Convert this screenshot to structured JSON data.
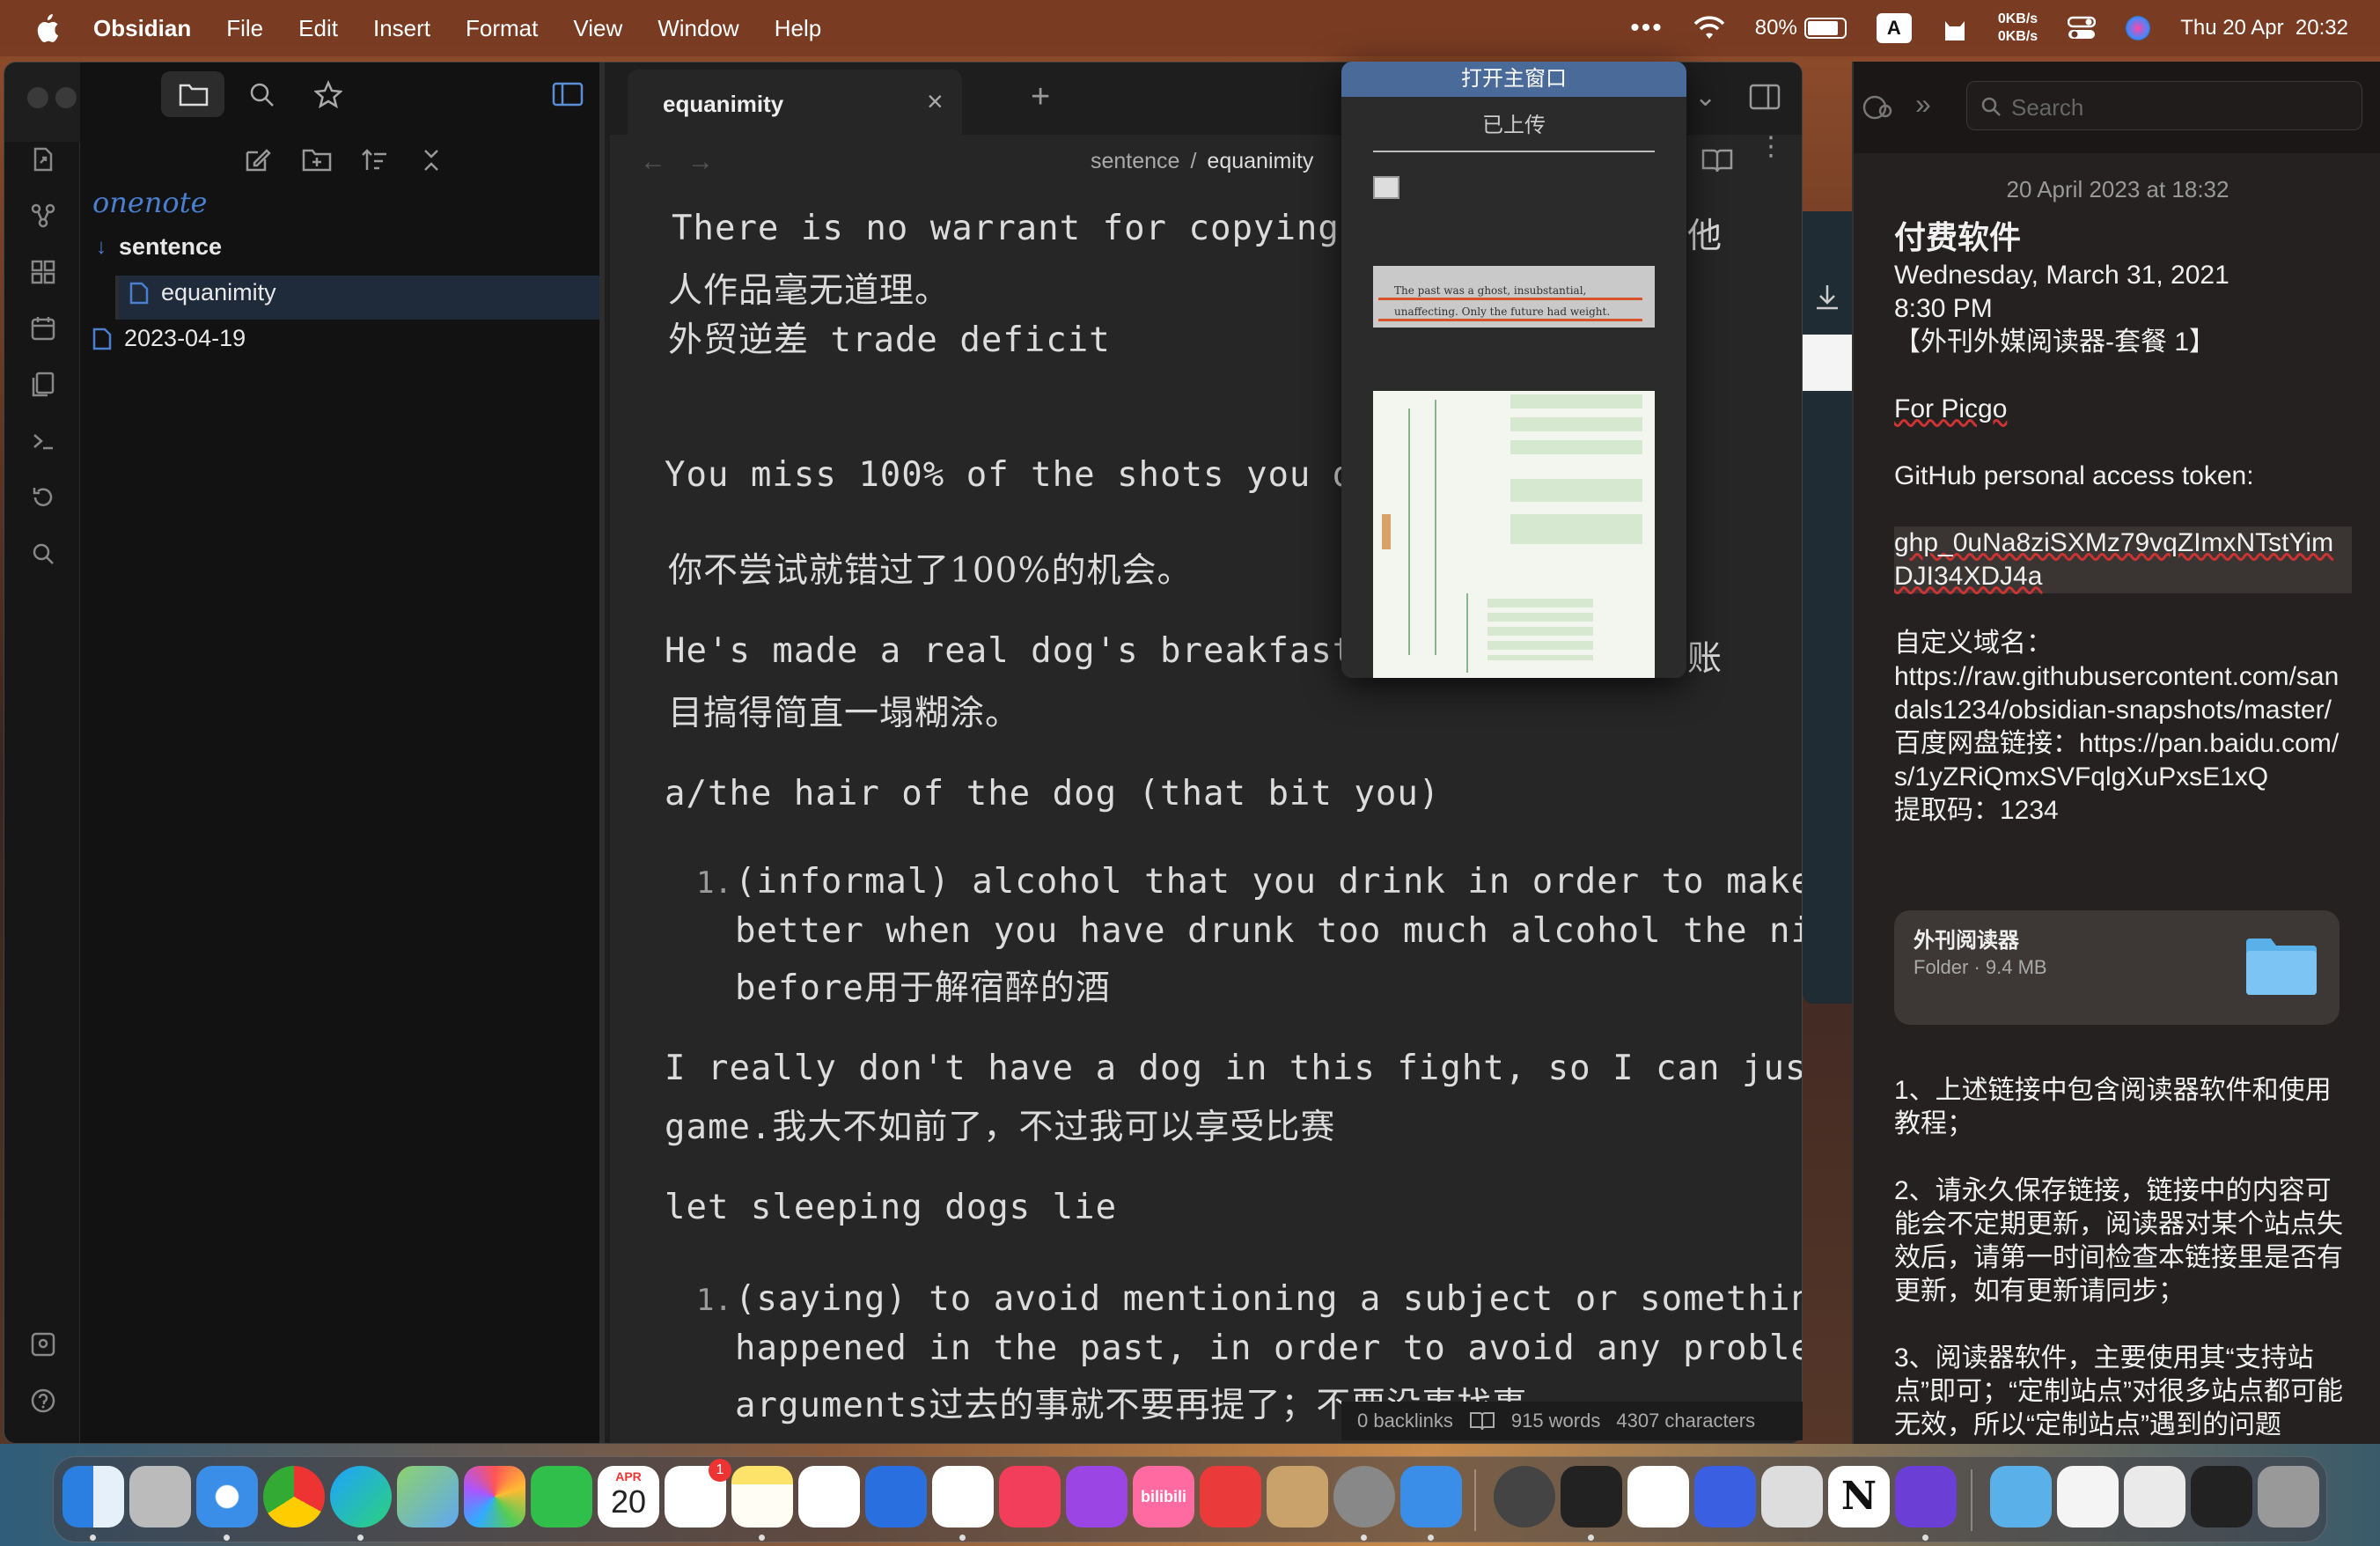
{
  "menubar": {
    "app_name": "Obsidian",
    "items": [
      "File",
      "Edit",
      "Insert",
      "Format",
      "View",
      "Window",
      "Help"
    ],
    "battery": "80%",
    "input_source": "A",
    "net_up": "0KB/s",
    "net_down": "0KB/s",
    "datetime": "Thu 20 Apr  20:32"
  },
  "filepane": {
    "vault": "onenote",
    "folder": "sentence",
    "items": [
      "equanimity",
      "2023-04-19"
    ]
  },
  "editor": {
    "tab": "equanimity",
    "breadcrumb_folder": "sentence",
    "breadcrumb_sep": "/",
    "breadcrumb_file": "equanimity",
    "lines": [
      "There is no warrant for copying other",
      "人作品毫无道理。",
      "外贸逆差 trade deficit",
      "You miss 100% of the shots you don't ta",
      "你不尝试就错过了100%的机会。",
      "He's made a real dog's breakfast of the",
      "目搞得简直一塌糊涂。",
      "a/the hair of the dog (that bit you)",
      "(informal) alcohol that you drink in order to make you feel",
      "better when you have drunk too much alcohol the night",
      "before用于解宿醉的酒",
      "I really don't have a dog in this fight, so I can just enjoy the",
      "game.我大不如前了，不过我可以享受比赛",
      "let sleeping dogs lie",
      "(saying) to avoid mentioning a subject or something that",
      "happened in the past, in order to avoid any problems or",
      "arguments过去的事就不要再提了；不要没事找事"
    ],
    "overflow_right": [
      "他",
      "账"
    ],
    "list_numbers": [
      "1.",
      "1."
    ]
  },
  "popup": {
    "title": "打开主窗口",
    "subtitle": "已上传",
    "thumb_text": "The past was a ghost, insubstantial, unaffecting. Only the future had weight."
  },
  "status": {
    "backlinks": "0 backlinks",
    "words": "915 words",
    "chars": "4307 characters"
  },
  "notes": {
    "search_placeholder": "Search",
    "date": "20 April 2023 at 18:32",
    "title": "付费软件",
    "lines": [
      "Wednesday, March 31, 2021",
      "8:30 PM",
      "【外刊外媒阅读器-套餐 1】",
      "",
      "For Picgo",
      "",
      "GitHub  personal access token:",
      "",
      "ghp_0uNa8ziSXMz79vqZImxNTstYimDJI34XDJ4a",
      "",
      "自定义域名：",
      "https://raw.githubusercontent.com/sandals1234/obsidian-snapshots/master/",
      "百度网盘链接：https://pan.baidu.com/s/1yZRiQmxSVFqlgXuPxsE1xQ",
      "提取码：1234"
    ],
    "folder_name": "外刊阅读器",
    "folder_meta": "Folder · 9.4 MB",
    "paras": [
      "1、上述链接中包含阅读器软件和使用教程；",
      "2、请永久保存链接，链接中的内容可能会不定期更新，阅读器对某个站点失效后，请第一时间检查本链接里是否有更新，如有更新请同步；",
      "3、阅读器软件，主要使用其“支持站点”即可；“定制站点”对很多站点都可能无效，所以“定制站点”遇到的问题"
    ]
  },
  "dock": {
    "calendar_month": "APR",
    "calendar_day": "20",
    "reminders_badge": "1",
    "bilibili_label": "bilibili",
    "notion_label": "N"
  }
}
